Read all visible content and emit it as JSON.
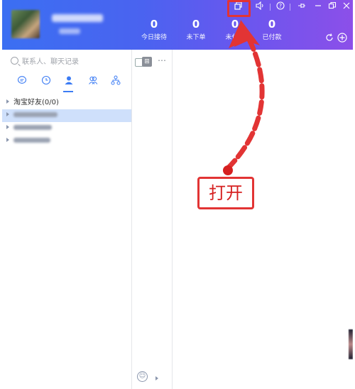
{
  "header": {
    "stats": [
      {
        "value": "0",
        "label": "今日接待"
      },
      {
        "value": "0",
        "label": "未下单"
      },
      {
        "value": "0",
        "label": "未付款"
      },
      {
        "value": "0",
        "label": "已付款"
      }
    ],
    "window_icons": [
      "multi-window-icon",
      "speaker-icon",
      "help-icon",
      "pin-icon",
      "minimize-icon",
      "restore-icon",
      "close-icon"
    ],
    "refresh_icon": "refresh-icon",
    "add_icon": "add-circle-icon"
  },
  "sidebar": {
    "search_placeholder": "联系人、聊天记录",
    "tabs": [
      "chat-icon",
      "clock-icon",
      "contact-icon",
      "group-icon",
      "org-icon"
    ],
    "active_tab": 2,
    "group_label": "淘宝好友(0/0)"
  },
  "annotation": {
    "label": "打开",
    "color": "#e23434"
  },
  "colors": {
    "header_start": "#3b6ff2",
    "header_end": "#8c4fe9",
    "accent": "#3c7cf4",
    "selection": "#cfe0fb"
  }
}
